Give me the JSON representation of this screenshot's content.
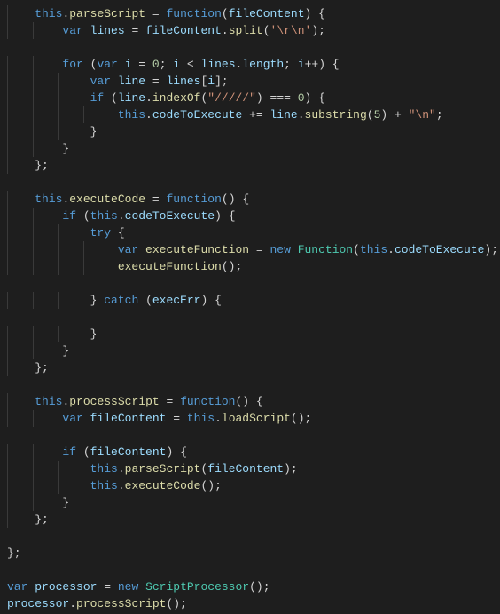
{
  "editor": {
    "language": "javascript",
    "theme": "dark-plus",
    "indentGuides": true,
    "lines": [
      [
        {
          "indent": 4
        },
        {
          "cls": "tok-this",
          "t": "this"
        },
        {
          "cls": "tok-punct",
          "t": "."
        },
        {
          "cls": "tok-fn",
          "t": "parseScript"
        },
        {
          "cls": "tok-op",
          "t": " = "
        },
        {
          "cls": "tok-kw",
          "t": "function"
        },
        {
          "cls": "tok-punct",
          "t": "("
        },
        {
          "cls": "tok-param",
          "t": "fileContent"
        },
        {
          "cls": "tok-punct",
          "t": ") "
        },
        {
          "cls": "tok-brace",
          "t": "{"
        }
      ],
      [
        {
          "indent": 8
        },
        {
          "cls": "tok-kw",
          "t": "var"
        },
        {
          "cls": "tok-op",
          "t": " "
        },
        {
          "cls": "tok-var",
          "t": "lines"
        },
        {
          "cls": "tok-op",
          "t": " = "
        },
        {
          "cls": "tok-var",
          "t": "fileContent"
        },
        {
          "cls": "tok-punct",
          "t": "."
        },
        {
          "cls": "tok-fn",
          "t": "split"
        },
        {
          "cls": "tok-punct",
          "t": "("
        },
        {
          "cls": "tok-str",
          "t": "'\\r\\n'"
        },
        {
          "cls": "tok-punct",
          "t": ");"
        }
      ],
      [
        {
          "indent": 0
        }
      ],
      [
        {
          "indent": 8
        },
        {
          "cls": "tok-kw",
          "t": "for"
        },
        {
          "cls": "tok-punct",
          "t": " ("
        },
        {
          "cls": "tok-kw",
          "t": "var"
        },
        {
          "cls": "tok-op",
          "t": " "
        },
        {
          "cls": "tok-var",
          "t": "i"
        },
        {
          "cls": "tok-op",
          "t": " = "
        },
        {
          "cls": "tok-num",
          "t": "0"
        },
        {
          "cls": "tok-punct",
          "t": "; "
        },
        {
          "cls": "tok-var",
          "t": "i"
        },
        {
          "cls": "tok-op",
          "t": " < "
        },
        {
          "cls": "tok-var",
          "t": "lines"
        },
        {
          "cls": "tok-punct",
          "t": "."
        },
        {
          "cls": "tok-var",
          "t": "length"
        },
        {
          "cls": "tok-punct",
          "t": "; "
        },
        {
          "cls": "tok-var",
          "t": "i"
        },
        {
          "cls": "tok-op",
          "t": "++"
        },
        {
          "cls": "tok-punct",
          "t": ") "
        },
        {
          "cls": "tok-brace",
          "t": "{"
        }
      ],
      [
        {
          "indent": 12
        },
        {
          "cls": "tok-kw",
          "t": "var"
        },
        {
          "cls": "tok-op",
          "t": " "
        },
        {
          "cls": "tok-var",
          "t": "line"
        },
        {
          "cls": "tok-op",
          "t": " = "
        },
        {
          "cls": "tok-var",
          "t": "lines"
        },
        {
          "cls": "tok-punct",
          "t": "["
        },
        {
          "cls": "tok-var",
          "t": "i"
        },
        {
          "cls": "tok-punct",
          "t": "];"
        }
      ],
      [
        {
          "indent": 12
        },
        {
          "cls": "tok-kw",
          "t": "if"
        },
        {
          "cls": "tok-punct",
          "t": " ("
        },
        {
          "cls": "tok-var",
          "t": "line"
        },
        {
          "cls": "tok-punct",
          "t": "."
        },
        {
          "cls": "tok-fn",
          "t": "indexOf"
        },
        {
          "cls": "tok-punct",
          "t": "("
        },
        {
          "cls": "tok-str",
          "t": "\"/////\""
        },
        {
          "cls": "tok-punct",
          "t": ") "
        },
        {
          "cls": "tok-op",
          "t": "==="
        },
        {
          "cls": "tok-punct",
          "t": " "
        },
        {
          "cls": "tok-num",
          "t": "0"
        },
        {
          "cls": "tok-punct",
          "t": ") "
        },
        {
          "cls": "tok-brace",
          "t": "{"
        }
      ],
      [
        {
          "indent": 16
        },
        {
          "cls": "tok-this",
          "t": "this"
        },
        {
          "cls": "tok-punct",
          "t": "."
        },
        {
          "cls": "tok-var",
          "t": "codeToExecute"
        },
        {
          "cls": "tok-op",
          "t": " += "
        },
        {
          "cls": "tok-var",
          "t": "line"
        },
        {
          "cls": "tok-punct",
          "t": "."
        },
        {
          "cls": "tok-fn",
          "t": "substring"
        },
        {
          "cls": "tok-punct",
          "t": "("
        },
        {
          "cls": "tok-num",
          "t": "5"
        },
        {
          "cls": "tok-punct",
          "t": ") "
        },
        {
          "cls": "tok-op",
          "t": "+"
        },
        {
          "cls": "tok-punct",
          "t": " "
        },
        {
          "cls": "tok-str",
          "t": "\"\\n\""
        },
        {
          "cls": "tok-punct",
          "t": ";"
        }
      ],
      [
        {
          "indent": 12
        },
        {
          "cls": "tok-brace",
          "t": "}"
        }
      ],
      [
        {
          "indent": 8
        },
        {
          "cls": "tok-brace",
          "t": "}"
        }
      ],
      [
        {
          "indent": 4
        },
        {
          "cls": "tok-brace",
          "t": "}"
        },
        {
          "cls": "tok-punct",
          "t": ";"
        }
      ],
      [
        {
          "indent": 0
        }
      ],
      [
        {
          "indent": 4
        },
        {
          "cls": "tok-this",
          "t": "this"
        },
        {
          "cls": "tok-punct",
          "t": "."
        },
        {
          "cls": "tok-fn",
          "t": "executeCode"
        },
        {
          "cls": "tok-op",
          "t": " = "
        },
        {
          "cls": "tok-kw",
          "t": "function"
        },
        {
          "cls": "tok-punct",
          "t": "() "
        },
        {
          "cls": "tok-brace",
          "t": "{"
        }
      ],
      [
        {
          "indent": 8
        },
        {
          "cls": "tok-kw",
          "t": "if"
        },
        {
          "cls": "tok-punct",
          "t": " ("
        },
        {
          "cls": "tok-this",
          "t": "this"
        },
        {
          "cls": "tok-punct",
          "t": "."
        },
        {
          "cls": "tok-var",
          "t": "codeToExecute"
        },
        {
          "cls": "tok-punct",
          "t": ") "
        },
        {
          "cls": "tok-brace",
          "t": "{"
        }
      ],
      [
        {
          "indent": 12
        },
        {
          "cls": "tok-kw",
          "t": "try"
        },
        {
          "cls": "tok-punct",
          "t": " "
        },
        {
          "cls": "tok-brace",
          "t": "{"
        }
      ],
      [
        {
          "indent": 16
        },
        {
          "cls": "tok-kw",
          "t": "var"
        },
        {
          "cls": "tok-op",
          "t": " "
        },
        {
          "cls": "tok-fn",
          "t": "executeFunction"
        },
        {
          "cls": "tok-op",
          "t": " = "
        },
        {
          "cls": "tok-kw",
          "t": "new"
        },
        {
          "cls": "tok-op",
          "t": " "
        },
        {
          "cls": "tok-type",
          "t": "Function"
        },
        {
          "cls": "tok-punct",
          "t": "("
        },
        {
          "cls": "tok-this",
          "t": "this"
        },
        {
          "cls": "tok-punct",
          "t": "."
        },
        {
          "cls": "tok-var",
          "t": "codeToExecute"
        },
        {
          "cls": "tok-punct",
          "t": ");"
        }
      ],
      [
        {
          "indent": 16
        },
        {
          "cls": "tok-fn",
          "t": "executeFunction"
        },
        {
          "cls": "tok-punct",
          "t": "();"
        }
      ],
      [
        {
          "indent": 0
        }
      ],
      [
        {
          "indent": 12
        },
        {
          "cls": "tok-brace",
          "t": "}"
        },
        {
          "cls": "tok-punct",
          "t": " "
        },
        {
          "cls": "tok-kw",
          "t": "catch"
        },
        {
          "cls": "tok-punct",
          "t": " ("
        },
        {
          "cls": "tok-var",
          "t": "execErr"
        },
        {
          "cls": "tok-punct",
          "t": ") "
        },
        {
          "cls": "tok-brace",
          "t": "{"
        }
      ],
      [
        {
          "indent": 0
        }
      ],
      [
        {
          "indent": 12
        },
        {
          "cls": "tok-brace",
          "t": "}"
        }
      ],
      [
        {
          "indent": 8
        },
        {
          "cls": "tok-brace",
          "t": "}"
        }
      ],
      [
        {
          "indent": 4
        },
        {
          "cls": "tok-brace",
          "t": "}"
        },
        {
          "cls": "tok-punct",
          "t": ";"
        }
      ],
      [
        {
          "indent": 0
        }
      ],
      [
        {
          "indent": 4
        },
        {
          "cls": "tok-this",
          "t": "this"
        },
        {
          "cls": "tok-punct",
          "t": "."
        },
        {
          "cls": "tok-fn",
          "t": "processScript"
        },
        {
          "cls": "tok-op",
          "t": " = "
        },
        {
          "cls": "tok-kw",
          "t": "function"
        },
        {
          "cls": "tok-punct",
          "t": "() "
        },
        {
          "cls": "tok-brace",
          "t": "{"
        }
      ],
      [
        {
          "indent": 8
        },
        {
          "cls": "tok-kw",
          "t": "var"
        },
        {
          "cls": "tok-op",
          "t": " "
        },
        {
          "cls": "tok-var",
          "t": "fileContent"
        },
        {
          "cls": "tok-op",
          "t": " = "
        },
        {
          "cls": "tok-this",
          "t": "this"
        },
        {
          "cls": "tok-punct",
          "t": "."
        },
        {
          "cls": "tok-fn",
          "t": "loadScript"
        },
        {
          "cls": "tok-punct",
          "t": "();"
        }
      ],
      [
        {
          "indent": 0
        }
      ],
      [
        {
          "indent": 8
        },
        {
          "cls": "tok-kw",
          "t": "if"
        },
        {
          "cls": "tok-punct",
          "t": " ("
        },
        {
          "cls": "tok-var",
          "t": "fileContent"
        },
        {
          "cls": "tok-punct",
          "t": ") "
        },
        {
          "cls": "tok-brace",
          "t": "{"
        }
      ],
      [
        {
          "indent": 12
        },
        {
          "cls": "tok-this",
          "t": "this"
        },
        {
          "cls": "tok-punct",
          "t": "."
        },
        {
          "cls": "tok-fn",
          "t": "parseScript"
        },
        {
          "cls": "tok-punct",
          "t": "("
        },
        {
          "cls": "tok-var",
          "t": "fileContent"
        },
        {
          "cls": "tok-punct",
          "t": ");"
        }
      ],
      [
        {
          "indent": 12
        },
        {
          "cls": "tok-this",
          "t": "this"
        },
        {
          "cls": "tok-punct",
          "t": "."
        },
        {
          "cls": "tok-fn",
          "t": "executeCode"
        },
        {
          "cls": "tok-punct",
          "t": "();"
        }
      ],
      [
        {
          "indent": 8
        },
        {
          "cls": "tok-brace",
          "t": "}"
        }
      ],
      [
        {
          "indent": 4
        },
        {
          "cls": "tok-brace",
          "t": "}"
        },
        {
          "cls": "tok-punct",
          "t": ";"
        }
      ],
      [
        {
          "indent": 0
        }
      ],
      [
        {
          "indent": 0
        },
        {
          "cls": "tok-brace",
          "t": "}"
        },
        {
          "cls": "tok-punct",
          "t": ";"
        }
      ],
      [
        {
          "indent": 0
        }
      ],
      [
        {
          "indent": 0
        },
        {
          "cls": "tok-kw",
          "t": "var"
        },
        {
          "cls": "tok-op",
          "t": " "
        },
        {
          "cls": "tok-var",
          "t": "processor"
        },
        {
          "cls": "tok-op",
          "t": " = "
        },
        {
          "cls": "tok-kw",
          "t": "new"
        },
        {
          "cls": "tok-op",
          "t": " "
        },
        {
          "cls": "tok-type",
          "t": "ScriptProcessor"
        },
        {
          "cls": "tok-punct",
          "t": "();"
        }
      ],
      [
        {
          "indent": 0
        },
        {
          "cls": "tok-var",
          "t": "processor"
        },
        {
          "cls": "tok-punct",
          "t": "."
        },
        {
          "cls": "tok-fn",
          "t": "processScript"
        },
        {
          "cls": "tok-punct",
          "t": "();"
        }
      ]
    ]
  }
}
